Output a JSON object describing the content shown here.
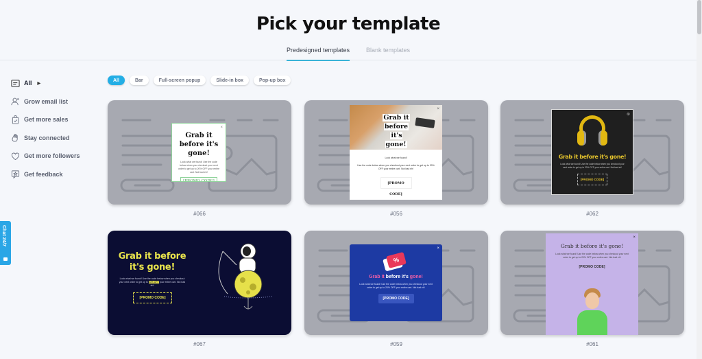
{
  "header": {
    "title": "Pick your template",
    "tabs": [
      {
        "label": "Predesigned templates",
        "active": true
      },
      {
        "label": "Blank templates",
        "active": false
      }
    ]
  },
  "sidebar": {
    "items": [
      {
        "label": "All",
        "icon": "layout-icon",
        "active": true
      },
      {
        "label": "Grow email list",
        "icon": "user-plus-icon"
      },
      {
        "label": "Get more sales",
        "icon": "shopping-bag-icon"
      },
      {
        "label": "Stay connected",
        "icon": "waving-hand-icon"
      },
      {
        "label": "Get more followers",
        "icon": "heart-icon"
      },
      {
        "label": "Get feedback",
        "icon": "feedback-star-icon"
      }
    ]
  },
  "filters": [
    {
      "label": "All",
      "active": true
    },
    {
      "label": "Bar"
    },
    {
      "label": "Full-screen popup"
    },
    {
      "label": "Slide-in box"
    },
    {
      "label": "Pop-up box"
    }
  ],
  "chat": {
    "label": "Chat 24/7"
  },
  "templates": [
    {
      "id": "#066",
      "headline": "Grab it before it's gone!",
      "body": "Look what we found! Use the code below when you checkout your next order to get up to 20% OFF your entire cart. Not bad eh!",
      "button": "[PROMO CODE]",
      "close": "×"
    },
    {
      "id": "#056",
      "headline_lines": [
        "Grab it",
        "before",
        "it's gone!"
      ],
      "intro": "Look what we found!",
      "body": "Use the code below when you checkout your next order to get up to 20% OFF your entire cart. Not bad eh!",
      "button": "[PROMO CODE]",
      "close": "×"
    },
    {
      "id": "#062",
      "headline": "Grab it before it's gone!",
      "body": "Look what we found! Use the code below when you checkout your next order to get up to 20% OFF your entire cart. Not bad eh!",
      "button": "[PROMO CODE]",
      "close": "⊗"
    },
    {
      "id": "#067",
      "headline_lines": [
        "Grab it before",
        "it's gone!"
      ],
      "body_pre": "Look what we found! Use the code below when you checkout your next order to get up to ",
      "body_highlight": "20% OFF",
      "body_post": " your entire cart. Not bad eh!",
      "button": "[PROMO CODE]"
    },
    {
      "id": "#059",
      "headline_pink1": "Grab it",
      "headline_white": " before it's ",
      "headline_pink2": "gone!",
      "ticket_symbol": "%",
      "body": "Look what we found! Use the code below when you checkout your next order to get up to 20% OFF your entire cart. Not bad eh!",
      "button": "[PROMO CODE]",
      "close": "×"
    },
    {
      "id": "#061",
      "headline": "Grab it before it's gone!",
      "body": "Look what we found! Use the code below when you checkout your next order to get up to 20% OFF your entire cart. Not bad eh!",
      "button": "[PROMO CODE]",
      "close": "×"
    }
  ]
}
